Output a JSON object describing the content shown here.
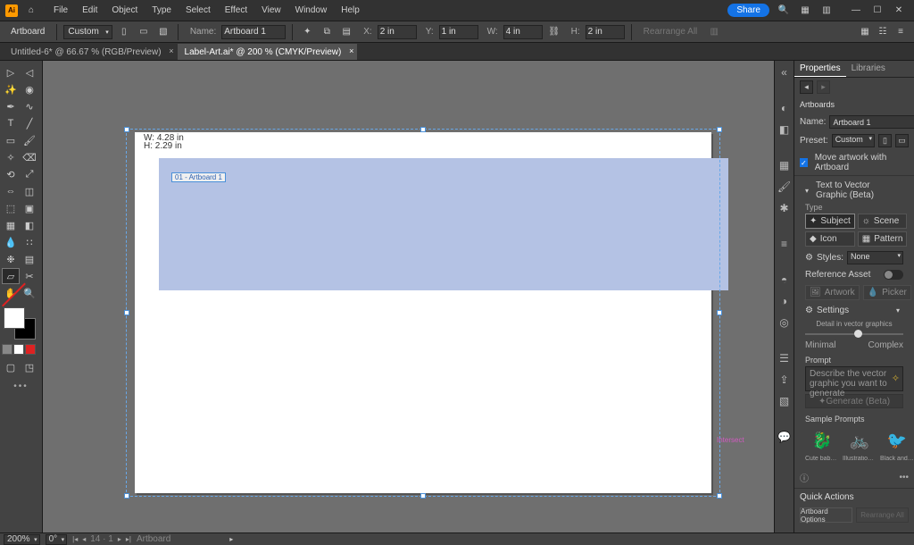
{
  "menubar": {
    "items": [
      "File",
      "Edit",
      "Object",
      "Type",
      "Select",
      "Effect",
      "View",
      "Window",
      "Help"
    ],
    "share": "Share"
  },
  "controlbar": {
    "tool_label": "Artboard",
    "preset": "Custom",
    "name_label": "Name:",
    "artboard_name": "Artboard 1",
    "x_label": "X:",
    "x_val": "2 in",
    "y_label": "Y:",
    "y_val": "1 in",
    "w_label": "W:",
    "w_val": "4 in",
    "h_label": "H:",
    "h_val": "2 in",
    "disabled": "Rearrange All"
  },
  "tabs": [
    {
      "title": "Untitled-6* @ 66.67 % (RGB/Preview)",
      "active": false
    },
    {
      "title": "Label-Art.ai* @ 200 % (CMYK/Preview)",
      "active": true
    }
  ],
  "canvas": {
    "dim_w": "W: 4.28 in",
    "dim_h": "H: 2.29 in",
    "inner_label": "01 - Artboard 1",
    "intersect": "Intersect"
  },
  "panel": {
    "tabs": [
      "Properties",
      "Libraries"
    ],
    "section_title": "Artboards",
    "name_label": "Name:",
    "name_value": "Artboard 1",
    "preset_label": "Preset:",
    "preset_value": "Custom",
    "move_artwork": "Move artwork with Artboard",
    "ttv_title": "Text to Vector Graphic (Beta)",
    "type_label": "Type",
    "types": {
      "subject": "Subject",
      "scene": "Scene",
      "icon": "Icon",
      "pattern": "Pattern"
    },
    "styles_label": "Styles:",
    "styles_value": "None",
    "ref_asset": "Reference Asset",
    "ref_btns": {
      "artwork": "Artwork",
      "picker": "Picker"
    },
    "settings": "Settings",
    "detail_title": "Detail in vector graphics",
    "detail_min": "Minimal",
    "detail_max": "Complex",
    "prompt_label": "Prompt",
    "prompt_placeholder": "Describe the vector graphic you want to generate",
    "generate": "Generate (Beta)",
    "samples_title": "Sample Prompts",
    "samples": [
      "Cute baby drag...",
      "Illustration of a...",
      "Black and white..."
    ],
    "qa_title": "Quick Actions",
    "qa_primary": "Artboard Options",
    "qa_secondary": "Rearrange All"
  },
  "status": {
    "zoom": "200%",
    "rotate": "0°",
    "nav_info": "14 · 1",
    "tool": "Artboard"
  }
}
